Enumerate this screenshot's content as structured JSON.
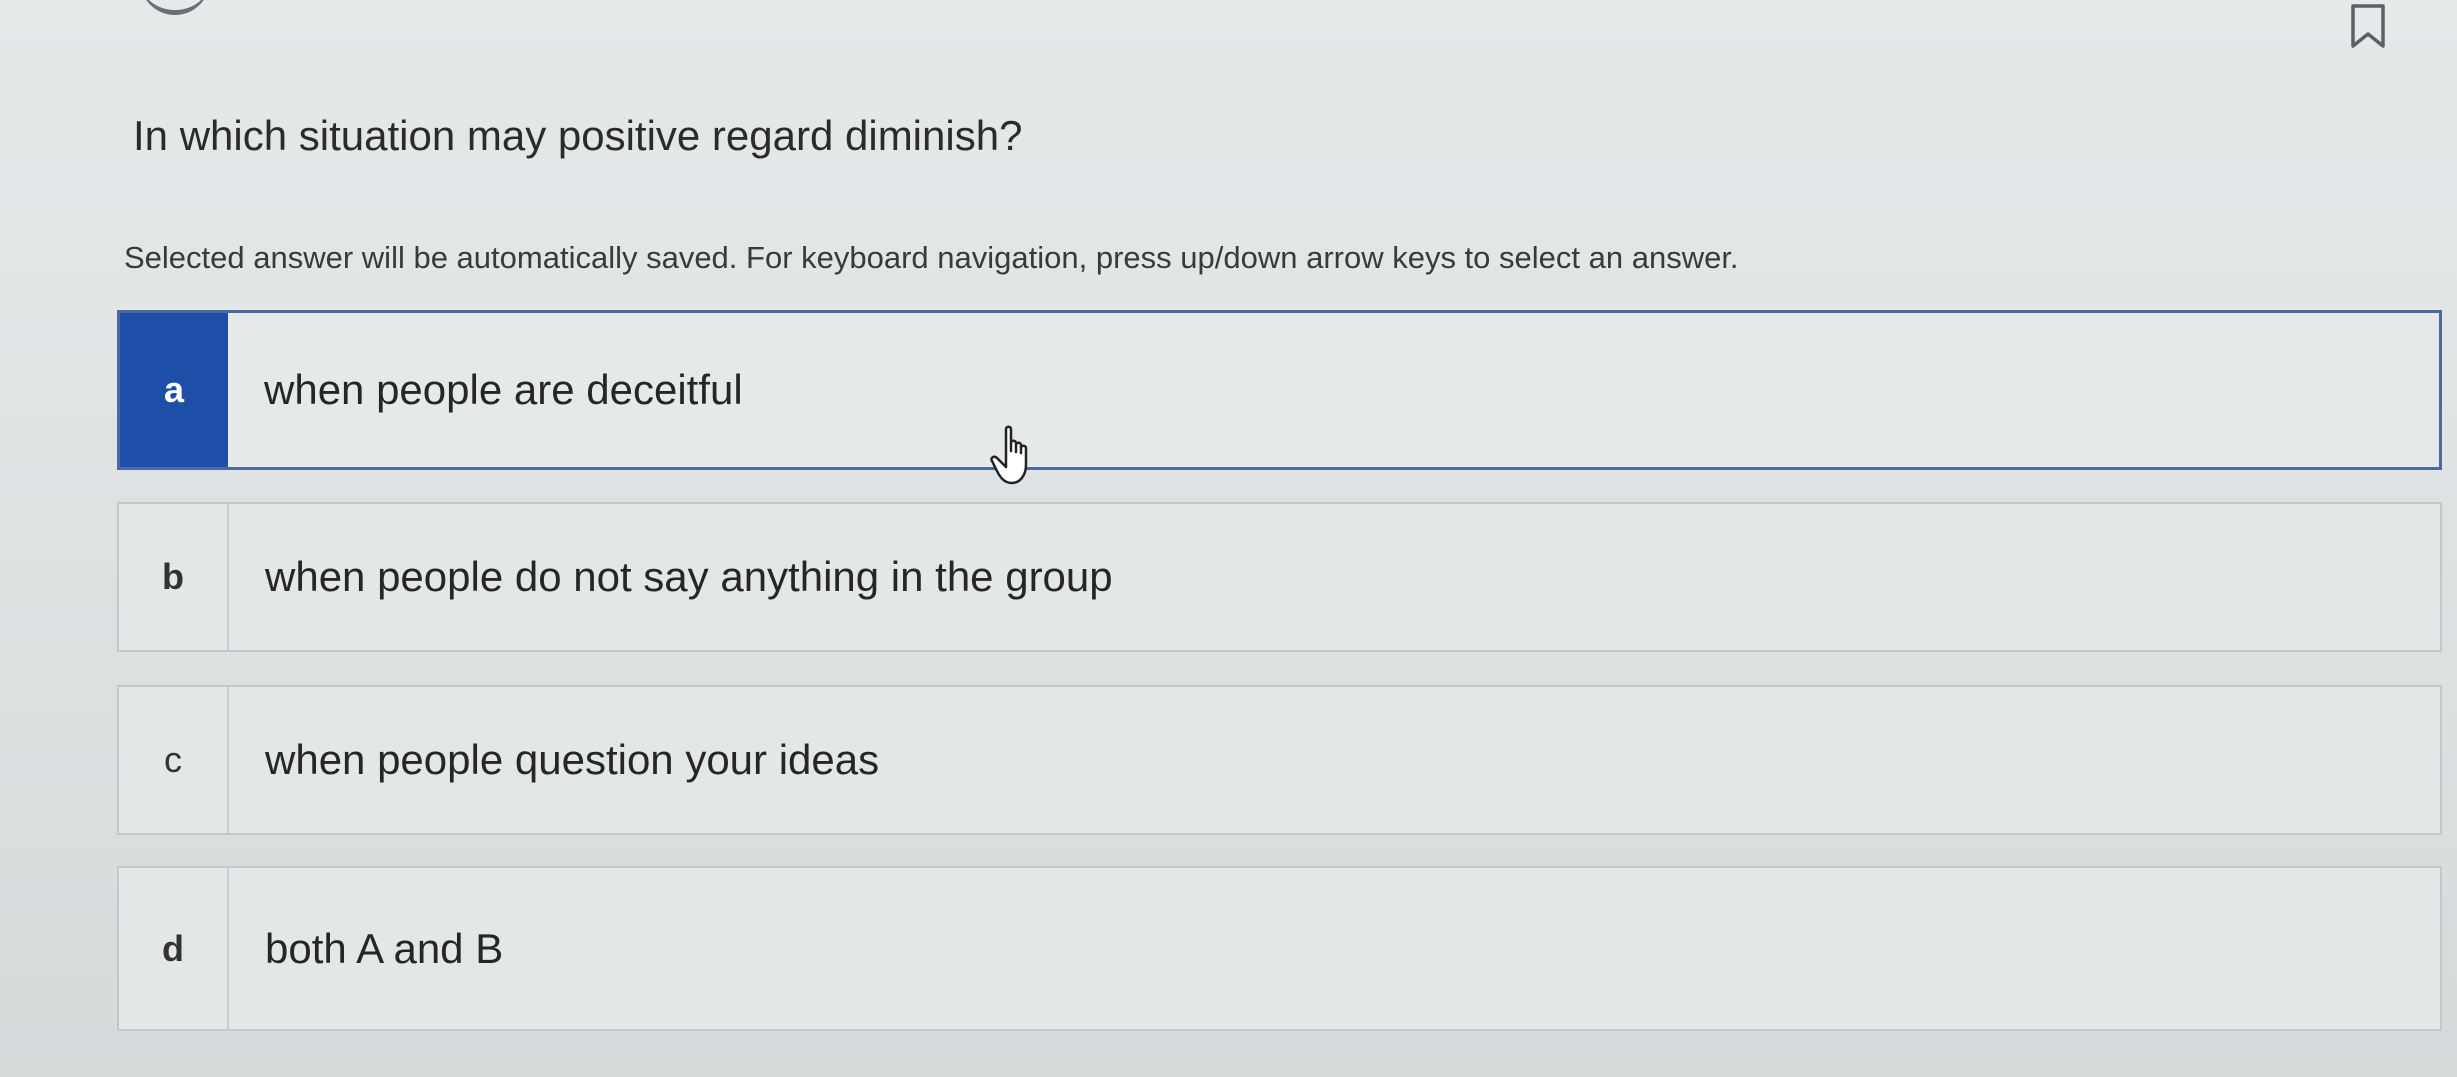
{
  "question": {
    "text": "In which situation may positive regard diminish?"
  },
  "instructions": "Selected answer will be automatically saved. For keyboard navigation, press up/down arrow keys to select an answer.",
  "options": [
    {
      "letter": "a",
      "text": "when people are deceitful",
      "selected": true
    },
    {
      "letter": "b",
      "text": "when people do not say anything in the group",
      "selected": false
    },
    {
      "letter": "c",
      "text": "when people question your ideas",
      "selected": false
    },
    {
      "letter": "d",
      "text": "both A and B",
      "selected": false
    }
  ],
  "colors": {
    "selected_letter_bg": "#1e4fa8",
    "selected_border": "#4a6aa0",
    "option_border": "#c4c8ca",
    "background": "#e3e6e7"
  },
  "icons": {
    "bookmark": "bookmark-icon",
    "cursor": "hand-pointer-icon"
  }
}
